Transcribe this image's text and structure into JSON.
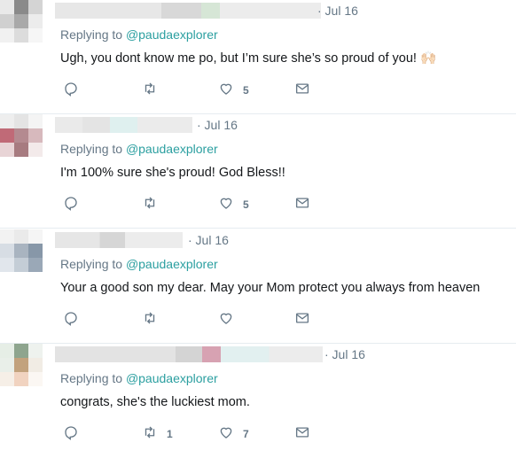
{
  "tweets": [
    {
      "date": "· Jul 16",
      "reply_prefix": "Replying to",
      "mention": "@paudaexplorer",
      "text": "Ugh, you dont know me po, but I’m sure she’s so proud of you! 🙌🏻",
      "replies": "",
      "retweets": "",
      "likes": "5"
    },
    {
      "date": "· Jul 16",
      "reply_prefix": "Replying to",
      "mention": "@paudaexplorer",
      "text": "I'm 100% sure she's proud! God Bless!!",
      "replies": "",
      "retweets": "",
      "likes": "5"
    },
    {
      "date": "· Jul 16",
      "reply_prefix": "Replying to",
      "mention": "@paudaexplorer",
      "text": "Your a good son my dear. May your Mom protect you always from heaven",
      "replies": "",
      "retweets": "",
      "likes": ""
    },
    {
      "date": "· Jul 16",
      "reply_prefix": "Replying to",
      "mention": "@paudaexplorer",
      "text": "congrats, she's the luckiest mom.",
      "replies": "",
      "retweets": "1",
      "likes": "7"
    }
  ],
  "icons": {
    "reply": "reply-icon",
    "retweet": "retweet-icon",
    "like": "heart-icon",
    "message": "envelope-icon"
  },
  "colors": {
    "mention": "#2b9fa0",
    "meta": "#657786",
    "divider": "#e6ecf0"
  }
}
